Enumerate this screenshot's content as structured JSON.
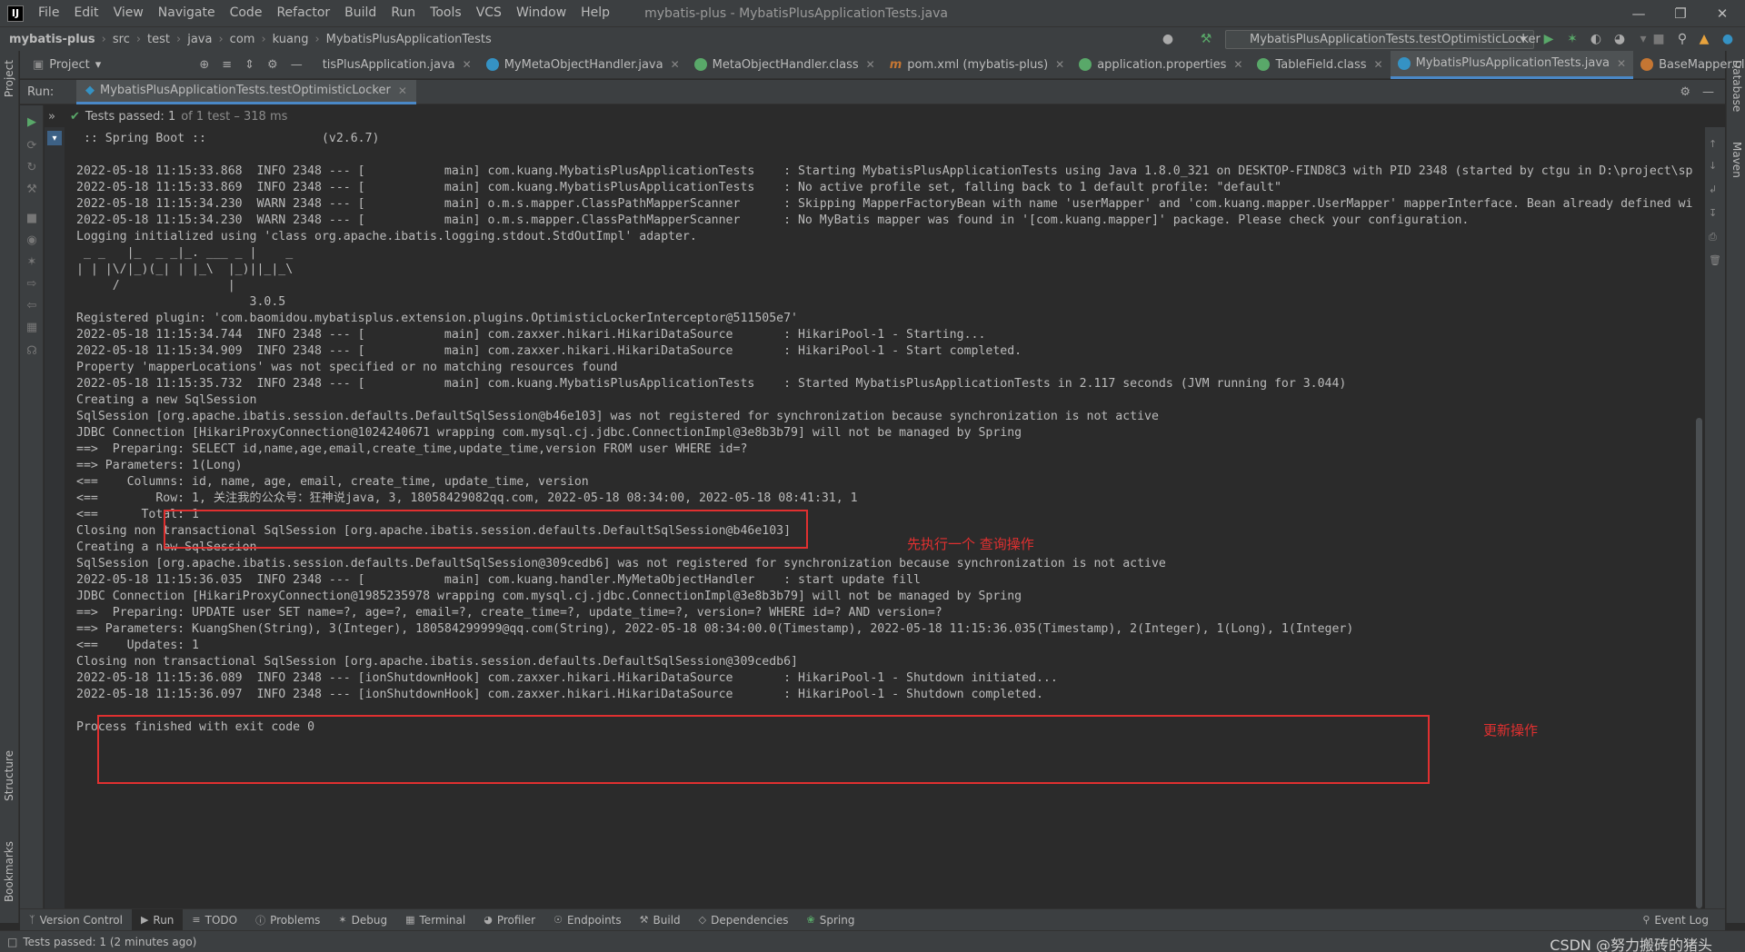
{
  "menubar": {
    "logo": "IJ",
    "items": [
      "File",
      "Edit",
      "View",
      "Navigate",
      "Code",
      "Refactor",
      "Build",
      "Run",
      "Tools",
      "VCS",
      "Window",
      "Help"
    ],
    "title": "mybatis-plus - MybatisPlusApplicationTests.java"
  },
  "navbar": {
    "crumbs": [
      "mybatis-plus",
      "src",
      "test",
      "java",
      "com",
      "kuang",
      "MybatisPlusApplicationTests"
    ],
    "run_config": "MybatisPlusApplicationTests.testOptimisticLocker"
  },
  "left_strip": {
    "project": "Project",
    "structure": "Structure",
    "bookmarks": "Bookmarks"
  },
  "right_strip": {
    "database": "Database",
    "maven": "Maven"
  },
  "tabbar": {
    "project_label": "Project",
    "tabs": [
      {
        "label": "tisPlusApplication.java",
        "color": "#3592c4"
      },
      {
        "label": "MyMetaObjectHandler.java",
        "color": "#3592c4"
      },
      {
        "label": "MetaObjectHandler.class",
        "color": "#59a869"
      },
      {
        "label": "pom.xml (mybatis-plus)",
        "color": "#c57633"
      },
      {
        "label": "application.properties",
        "color": "#59a869"
      },
      {
        "label": "TableField.class",
        "color": "#59a869"
      },
      {
        "label": "MybatisPlusApplicationTests.java",
        "color": "#3592c4"
      },
      {
        "label": "BaseMapper.class",
        "color": "#c57633"
      }
    ]
  },
  "run_panel": {
    "label": "Run:",
    "tab": "MybatisPlusApplicationTests.testOptimisticLocker"
  },
  "test_status": {
    "passed": "Tests passed: 1",
    "detail": "of 1 test – 318 ms"
  },
  "console_lines": [
    " :: Spring Boot ::                (v2.6.7)",
    "",
    "2022-05-18 11:15:33.868  INFO 2348 --- [           main] com.kuang.MybatisPlusApplicationTests    : Starting MybatisPlusApplicationTests using Java 1.8.0_321 on DESKTOP-FIND8C3 with PID 2348 (started by ctgu in D:\\project\\sp",
    "2022-05-18 11:15:33.869  INFO 2348 --- [           main] com.kuang.MybatisPlusApplicationTests    : No active profile set, falling back to 1 default profile: \"default\"",
    "2022-05-18 11:15:34.230  WARN 2348 --- [           main] o.m.s.mapper.ClassPathMapperScanner      : Skipping MapperFactoryBean with name 'userMapper' and 'com.kuang.mapper.UserMapper' mapperInterface. Bean already defined wi",
    "2022-05-18 11:15:34.230  WARN 2348 --- [           main] o.m.s.mapper.ClassPathMapperScanner      : No MyBatis mapper was found in '[com.kuang.mapper]' package. Please check your configuration.",
    "Logging initialized using 'class org.apache.ibatis.logging.stdout.StdOutImpl' adapter.",
    " _ _   |_  _ _|_. ___ _ |    _",
    "| | |\\/|_)(_| | |_\\  |_)||_|_\\",
    "     /               |",
    "                        3.0.5",
    "Registered plugin: 'com.baomidou.mybatisplus.extension.plugins.OptimisticLockerInterceptor@511505e7'",
    "2022-05-18 11:15:34.744  INFO 2348 --- [           main] com.zaxxer.hikari.HikariDataSource       : HikariPool-1 - Starting...",
    "2022-05-18 11:15:34.909  INFO 2348 --- [           main] com.zaxxer.hikari.HikariDataSource       : HikariPool-1 - Start completed.",
    "Property 'mapperLocations' was not specified or no matching resources found",
    "2022-05-18 11:15:35.732  INFO 2348 --- [           main] com.kuang.MybatisPlusApplicationTests    : Started MybatisPlusApplicationTests in 2.117 seconds (JVM running for 3.044)",
    "Creating a new SqlSession",
    "SqlSession [org.apache.ibatis.session.defaults.DefaultSqlSession@b46e103] was not registered for synchronization because synchronization is not active",
    "JDBC Connection [HikariProxyConnection@1024240671 wrapping com.mysql.cj.jdbc.ConnectionImpl@3e8b3b79] will not be managed by Spring",
    "==>  Preparing: SELECT id,name,age,email,create_time,update_time,version FROM user WHERE id=?",
    "==> Parameters: 1(Long)",
    "<==    Columns: id, name, age, email, create_time, update_time, version",
    "<==        Row: 1, 关注我的公众号：狂神说java, 3, 18058429082qq.com, 2022-05-18 08:34:00, 2022-05-18 08:41:31, 1",
    "<==      Total: 1",
    "Closing non transactional SqlSession [org.apache.ibatis.session.defaults.DefaultSqlSession@b46e103]",
    "Creating a new SqlSession",
    "SqlSession [org.apache.ibatis.session.defaults.DefaultSqlSession@309cedb6] was not registered for synchronization because synchronization is not active",
    "2022-05-18 11:15:36.035  INFO 2348 --- [           main] com.kuang.handler.MyMetaObjectHandler    : start update fill",
    "JDBC Connection [HikariProxyConnection@1985235978 wrapping com.mysql.cj.jdbc.ConnectionImpl@3e8b3b79] will not be managed by Spring",
    "==>  Preparing: UPDATE user SET name=?, age=?, email=?, create_time=?, update_time=?, version=? WHERE id=? AND version=?",
    "==> Parameters: KuangShen(String), 3(Integer), 180584299999@qq.com(String), 2022-05-18 08:34:00.0(Timestamp), 2022-05-18 11:15:36.035(Timestamp), 2(Integer), 1(Long), 1(Integer)",
    "<==    Updates: 1",
    "Closing non transactional SqlSession [org.apache.ibatis.session.defaults.DefaultSqlSession@309cedb6]",
    "2022-05-18 11:15:36.089  INFO 2348 --- [ionShutdownHook] com.zaxxer.hikari.HikariDataSource       : HikariPool-1 - Shutdown initiated...",
    "2022-05-18 11:15:36.097  INFO 2348 --- [ionShutdownHook] com.zaxxer.hikari.HikariDataSource       : HikariPool-1 - Shutdown completed.",
    "",
    "Process finished with exit code 0"
  ],
  "annotations": {
    "query": "先执行一个 查询操作",
    "update": "更新操作"
  },
  "bottom_tabs": [
    "Version Control",
    "Run",
    "TODO",
    "Problems",
    "Debug",
    "Terminal",
    "Profiler",
    "Endpoints",
    "Build",
    "Dependencies",
    "Spring"
  ],
  "event_log": "Event Log",
  "statusbar": {
    "text": "Tests passed: 1 (2 minutes ago)",
    "watermark": "CSDN @努力搬砖的猪头"
  },
  "colors": {
    "accent": "#4a88c7",
    "highlight": "#e03030",
    "success": "#59a869"
  }
}
